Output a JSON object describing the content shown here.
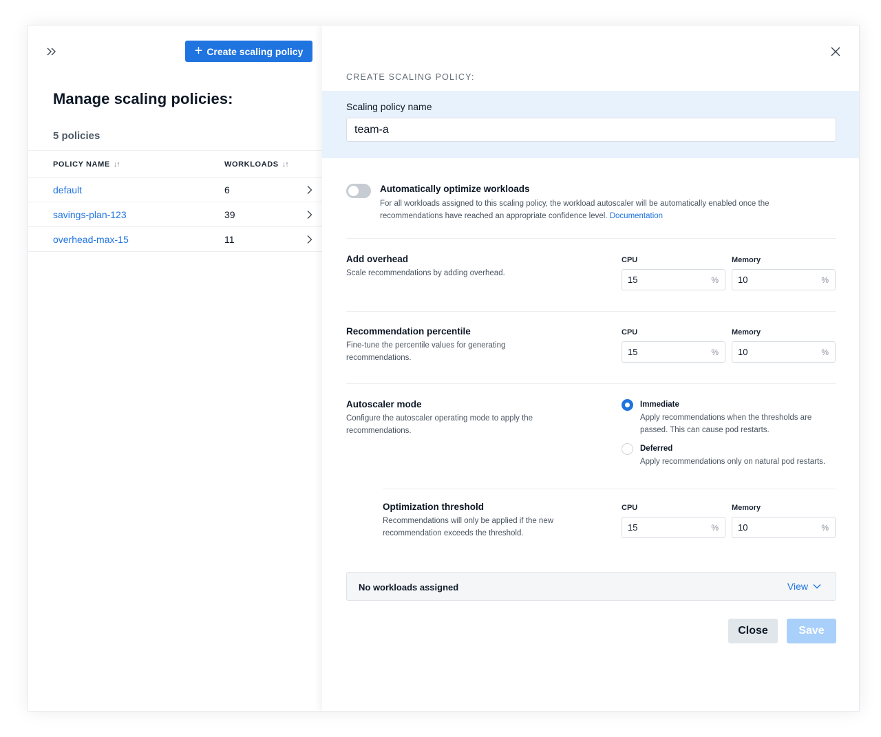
{
  "left": {
    "create_button_label": "Create scaling policy",
    "heading": "Manage scaling policies:",
    "policy_count": "5 policies",
    "columns": {
      "policy_name": "POLICY NAME",
      "workloads": "WORKLOADS"
    },
    "rows": [
      {
        "name": "default",
        "workloads": "6"
      },
      {
        "name": "savings-plan-123",
        "workloads": "39"
      },
      {
        "name": "overhead-max-15",
        "workloads": "11"
      }
    ]
  },
  "panel": {
    "title": "CREATE SCALING POLICY:",
    "name_label": "Scaling policy name",
    "name_value": "team-a",
    "auto_optimize": {
      "title": "Automatically optimize workloads",
      "description": "For all workloads assigned to this scaling policy, the workload autoscaler will be automatically enabled once the recommendations have reached an appropriate confidence level.",
      "link": "Documentation",
      "enabled": false
    },
    "overhead": {
      "title": "Add overhead",
      "description": "Scale recommendations by adding overhead.",
      "cpu_label": "CPU",
      "cpu_value": "15",
      "memory_label": "Memory",
      "memory_value": "10",
      "unit": "%"
    },
    "percentile": {
      "title": "Recommendation percentile",
      "description": "Fine-tune the percentile values for generating recommendations.",
      "cpu_label": "CPU",
      "cpu_value": "15",
      "memory_label": "Memory",
      "memory_value": "10",
      "unit": "%"
    },
    "mode": {
      "title": "Autoscaler mode",
      "description": "Configure the autoscaler operating mode to apply the recommendations.",
      "options": [
        {
          "label": "Immediate",
          "description": "Apply recommendations when the thresholds are passed. This can cause pod restarts.",
          "selected": true
        },
        {
          "label": "Deferred",
          "description": "Apply recommendations only on natural pod restarts.",
          "selected": false
        }
      ]
    },
    "threshold": {
      "title": "Optimization threshold",
      "description": "Recommendations will only be applied if the new recommendation exceeds the threshold.",
      "cpu_label": "CPU",
      "cpu_value": "15",
      "memory_label": "Memory",
      "memory_value": "10",
      "unit": "%"
    },
    "workloads_bar": {
      "text": "No workloads assigned",
      "view_label": "View"
    },
    "close_label": "Close",
    "save_label": "Save"
  },
  "colors": {
    "accent": "#1f74e0",
    "band": "#e8f2fd",
    "save_disabled": "#a9d0fa"
  },
  "icons": [
    "chevrons-right-icon",
    "plus-icon",
    "sort-icon",
    "chevron-right-icon",
    "close-icon",
    "chevron-down-icon"
  ]
}
